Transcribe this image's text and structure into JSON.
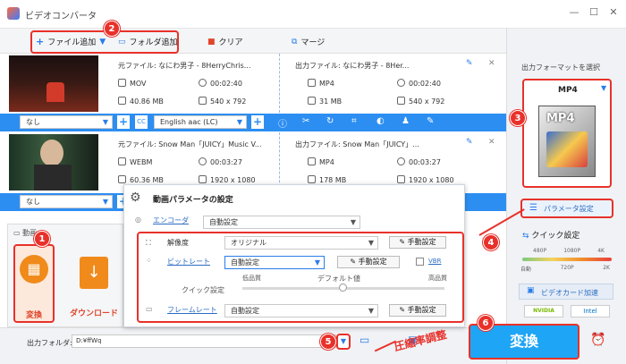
{
  "app": {
    "title": "ビデオコンバータ"
  },
  "toolbar": {
    "add_file": "ファイル追加",
    "add_folder": "フォルダ追加",
    "clear": "クリア",
    "merge": "マージ"
  },
  "files": [
    {
      "source_name": "元ファイル: なにわ男子 - 8HerryChris...",
      "format": "MOV",
      "duration": "00:02:40",
      "size": "40.86 MB",
      "resolution": "540 x 792",
      "output_name": "出力ファイル: なにわ男子 - 8Her...",
      "out_format": "MP4",
      "out_duration": "00:02:40",
      "out_size": "31 MB",
      "out_resolution": "540 x 792",
      "subtitle": "なし",
      "audio": "English aac (LC)"
    },
    {
      "source_name": "元ファイル: Snow Man「JUICY」Music V...",
      "format": "WEBM",
      "duration": "00:03:27",
      "size": "60.36 MB",
      "resolution": "1920 x 1080",
      "output_name": "出力ファイル: Snow Man「JUICY」...",
      "out_format": "MP4",
      "out_duration": "00:03:27",
      "out_size": "178 MB",
      "out_resolution": "1920 x 1080",
      "subtitle": "なし"
    }
  ],
  "right_panel": {
    "output_format_label": "出力フォーマットを選択",
    "format": "MP4",
    "param_button": "パラメータ設定",
    "quick_label": "クイック設定",
    "quick_top": [
      "480P",
      "1080P",
      "4K"
    ],
    "quick_bottom": [
      "自動",
      "720P",
      "2K"
    ],
    "gpu_label": "ビデオカード加速",
    "gpu_brands": [
      "NVIDIA",
      "Intel"
    ]
  },
  "left_tabs": {
    "header": "動画",
    "convert": "変換",
    "download": "ダウンロード"
  },
  "params": {
    "title": "動画パラメータの設定",
    "encoder_label": "エンコーダ",
    "encoder_value": "自動設定",
    "resolution_label": "解像度",
    "resolution_value": "オリジナル",
    "manual": "手動設定",
    "bitrate_label": "ビットレート",
    "bitrate_value": "自動設定",
    "vbr": "VBR",
    "quick_settings": "クイック設定",
    "low": "低品質",
    "default": "デフォルト値",
    "high": "高品質",
    "framerate_label": "フレームレート",
    "framerate_value": "自動設定"
  },
  "bottom": {
    "output_folder_label": "出力フォルダ:",
    "output_folder_value": "D:¥ffWq",
    "convert_button": "変換"
  },
  "annotations": {
    "n1": "1",
    "n2": "2",
    "n3": "3",
    "n4": "4",
    "n5": "5",
    "n6": "6",
    "compress": "圧縮率調整"
  },
  "colors": {
    "accent": "#2d8ef2",
    "annotation": "#e8312a",
    "convert": "#1fa5f5"
  }
}
